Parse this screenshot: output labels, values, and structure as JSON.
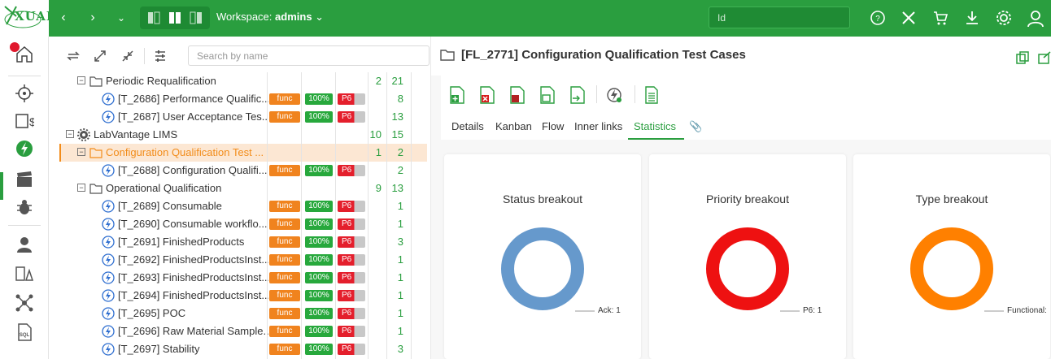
{
  "app": {
    "logo_text": "XUAL",
    "workspace_label": "Workspace:",
    "workspace_name": "admins",
    "id_placeholder": "Id"
  },
  "tree_toolbar": {
    "search_placeholder": "Search by name"
  },
  "tree": [
    {
      "type": "folder",
      "label": "Periodic Requalification",
      "n1": "2",
      "n2": "21"
    },
    {
      "type": "test",
      "label": "[T_2686] Performance Qualific...",
      "func": "func",
      "pct": "100%",
      "prio": "P6",
      "n2": "8"
    },
    {
      "type": "test",
      "label": "[T_2687] User Acceptance Tes...",
      "func": "func",
      "pct": "100%",
      "prio": "P6",
      "n2": "13"
    },
    {
      "type": "project",
      "label": "LabVantage LIMS",
      "n1": "10",
      "n2": "15"
    },
    {
      "type": "folder",
      "label": "Configuration Qualification Test ...",
      "n1": "1",
      "n2": "2",
      "selected": true
    },
    {
      "type": "test",
      "label": "[T_2688] Configuration Qualifi...",
      "func": "func",
      "pct": "100%",
      "prio": "P6",
      "n2": "2"
    },
    {
      "type": "folder",
      "label": "Operational Qualification",
      "n1": "9",
      "n2": "13"
    },
    {
      "type": "test",
      "label": "[T_2689] Consumable",
      "func": "func",
      "pct": "100%",
      "prio": "P6",
      "n2": "1"
    },
    {
      "type": "test",
      "label": "[T_2690] Consumable workflo...",
      "func": "func",
      "pct": "100%",
      "prio": "P6",
      "n2": "1"
    },
    {
      "type": "test",
      "label": "[T_2691] FinishedProducts",
      "func": "func",
      "pct": "100%",
      "prio": "P6",
      "n2": "3"
    },
    {
      "type": "test",
      "label": "[T_2692] FinishedProductsInst...",
      "func": "func",
      "pct": "100%",
      "prio": "P6",
      "n2": "1"
    },
    {
      "type": "test",
      "label": "[T_2693] FinishedProductsInst...",
      "func": "func",
      "pct": "100%",
      "prio": "P6",
      "n2": "1"
    },
    {
      "type": "test",
      "label": "[T_2694] FinishedProductsInst...",
      "func": "func",
      "pct": "100%",
      "prio": "P6",
      "n2": "1"
    },
    {
      "type": "test",
      "label": "[T_2695] POC",
      "func": "func",
      "pct": "100%",
      "prio": "P6",
      "n2": "1"
    },
    {
      "type": "test",
      "label": "[T_2696] Raw Material Sample...",
      "func": "func",
      "pct": "100%",
      "prio": "P6",
      "n2": "1"
    },
    {
      "type": "test",
      "label": "[T_2697] Stability",
      "func": "func",
      "pct": "100%",
      "prio": "P6",
      "n2": "3"
    }
  ],
  "detail": {
    "title": "[FL_2771] Configuration Qualification Test Cases",
    "tabs": [
      "Details",
      "Kanban",
      "Flow",
      "Inner links",
      "Statistics"
    ],
    "active_tab": "Statistics"
  },
  "cards": [
    {
      "title": "Status breakout",
      "legend": "Ack: 1",
      "color": "#6699cc"
    },
    {
      "title": "Priority breakout",
      "legend": "P6: 1",
      "color": "#ee1111"
    },
    {
      "title": "Type breakout",
      "legend": "Functional:",
      "color": "#ff8000"
    }
  ],
  "colors": {
    "brand": "#2a9e3f",
    "selected_row": "#fce7d3",
    "selected_text": "#f28c1a"
  }
}
